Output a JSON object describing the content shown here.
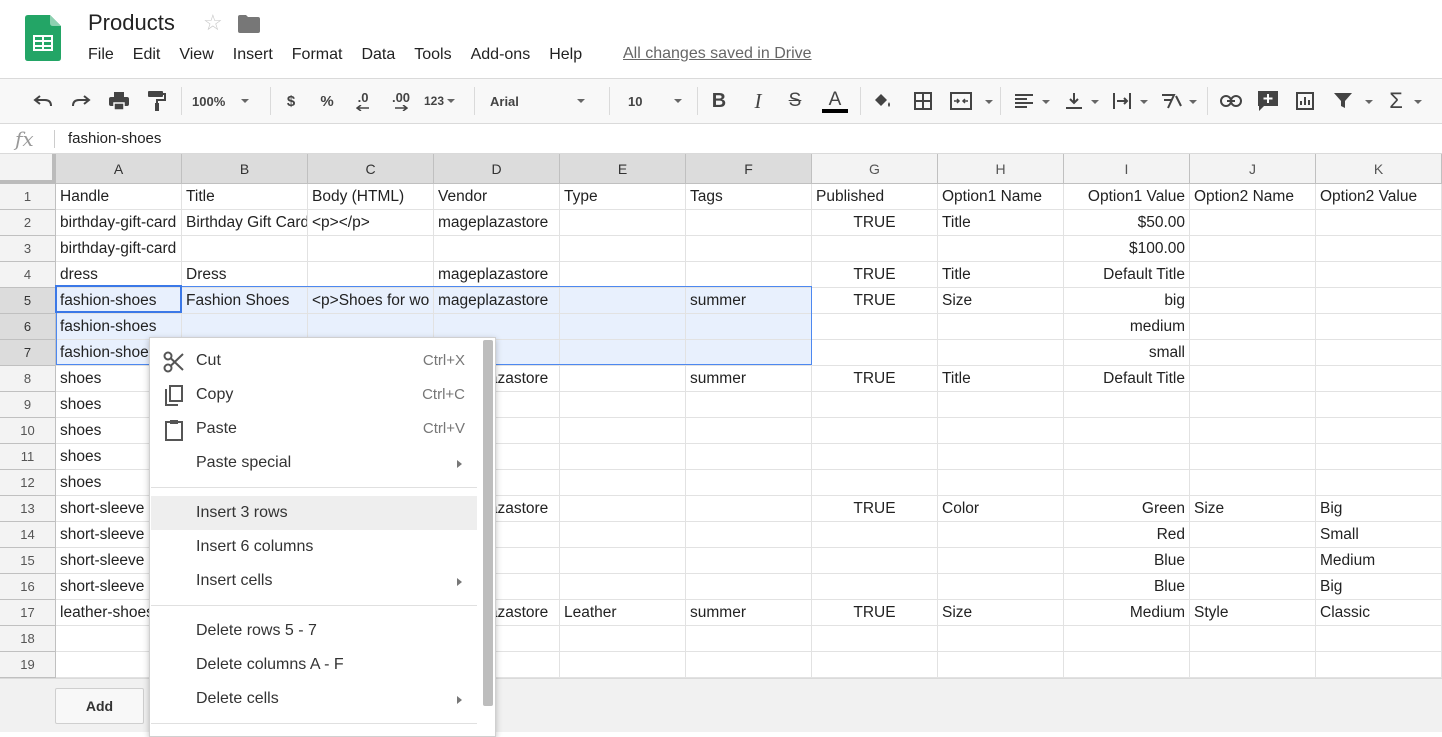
{
  "app": {
    "doc_title": "Products",
    "save_status": "All changes saved in Drive",
    "colors": {
      "sheets_green": "#23a566",
      "selection_blue": "#4d88f0",
      "selection_fill": "#e8f0fd"
    }
  },
  "menubar": [
    "File",
    "Edit",
    "View",
    "Insert",
    "Format",
    "Data",
    "Tools",
    "Add-ons",
    "Help"
  ],
  "toolbar": {
    "zoom": "100%",
    "currency": "$",
    "percent": "%",
    "decrease_decimal": ".0",
    "increase_decimal": ".00",
    "more_formats": "123",
    "font": "Arial",
    "font_size": "10",
    "bold": "B",
    "italic": "I",
    "strikethrough": "S",
    "text_color": "A"
  },
  "formula_bar": {
    "fx": "fx",
    "value": "fashion-shoes"
  },
  "grid": {
    "columns": [
      "A",
      "B",
      "C",
      "D",
      "E",
      "F",
      "G",
      "H",
      "I",
      "J",
      "K"
    ],
    "selected_columns": [
      0,
      1,
      2,
      3,
      4,
      5
    ],
    "rows": [
      {
        "num": "1",
        "cells": [
          "Handle",
          "Title",
          "Body (HTML)",
          "Vendor",
          "Type",
          "Tags",
          "Published",
          "Option1 Name",
          "Option1 Value",
          "Option2 Name",
          "Option2 Value"
        ]
      },
      {
        "num": "2",
        "cells": [
          "birthday-gift-card",
          "Birthday Gift Card",
          "<p></p>",
          "mageplazastore",
          "",
          "",
          "TRUE",
          "Title",
          "$50.00",
          "",
          ""
        ]
      },
      {
        "num": "3",
        "cells": [
          "birthday-gift-card",
          "",
          "",
          "",
          "",
          "",
          "",
          "",
          "$100.00",
          "",
          ""
        ]
      },
      {
        "num": "4",
        "cells": [
          "dress",
          "Dress",
          "",
          "mageplazastore",
          "",
          "",
          "TRUE",
          "Title",
          "Default Title",
          "",
          ""
        ]
      },
      {
        "num": "5",
        "cells": [
          "fashion-shoes",
          "Fashion Shoes",
          "<p>Shoes for wo",
          "mageplazastore",
          "",
          "summer",
          "TRUE",
          "Size",
          "big",
          "",
          ""
        ]
      },
      {
        "num": "6",
        "cells": [
          "fashion-shoes",
          "",
          "",
          "",
          "",
          "",
          "",
          "",
          "medium",
          "",
          ""
        ]
      },
      {
        "num": "7",
        "cells": [
          "fashion-shoes",
          "",
          "",
          "",
          "",
          "",
          "",
          "",
          "small",
          "",
          ""
        ]
      },
      {
        "num": "8",
        "cells": [
          "shoes",
          "",
          "",
          "mageplazastore",
          "",
          "summer",
          "TRUE",
          "Title",
          "Default Title",
          "",
          ""
        ]
      },
      {
        "num": "9",
        "cells": [
          "shoes",
          "",
          "",
          "",
          "",
          "",
          "",
          "",
          "",
          "",
          ""
        ]
      },
      {
        "num": "10",
        "cells": [
          "shoes",
          "",
          "",
          "",
          "",
          "",
          "",
          "",
          "",
          "",
          ""
        ]
      },
      {
        "num": "11",
        "cells": [
          "shoes",
          "",
          "",
          "",
          "",
          "",
          "",
          "",
          "",
          "",
          ""
        ]
      },
      {
        "num": "12",
        "cells": [
          "shoes",
          "",
          "",
          "",
          "",
          "",
          "",
          "",
          "",
          "",
          ""
        ]
      },
      {
        "num": "13",
        "cells": [
          "short-sleeve",
          "",
          "",
          "mageplazastore",
          "",
          "",
          "TRUE",
          "Color",
          "Green",
          "Size",
          "Big"
        ]
      },
      {
        "num": "14",
        "cells": [
          "short-sleeve",
          "",
          "",
          "",
          "",
          "",
          "",
          "",
          "Red",
          "",
          "Small"
        ]
      },
      {
        "num": "15",
        "cells": [
          "short-sleeve",
          "",
          "",
          "",
          "",
          "",
          "",
          "",
          "Blue",
          "",
          "Medium"
        ]
      },
      {
        "num": "16",
        "cells": [
          "short-sleeve",
          "",
          "",
          "",
          "",
          "",
          "",
          "",
          "Blue",
          "",
          "Big"
        ]
      },
      {
        "num": "17",
        "cells": [
          "leather-shoes",
          "",
          "",
          "mageplazastore",
          "Leather",
          "summer",
          "TRUE",
          "Size",
          "Medium",
          "Style",
          "Classic"
        ]
      },
      {
        "num": "18",
        "cells": [
          "",
          "",
          "",
          "",
          "",
          "",
          "",
          "",
          "",
          "",
          ""
        ]
      },
      {
        "num": "19",
        "cells": [
          "",
          "",
          "",
          "",
          "",
          "",
          "",
          "",
          "",
          "",
          ""
        ]
      }
    ]
  },
  "footer": {
    "add_label": "Add"
  },
  "context_menu": {
    "items": [
      {
        "label": "Cut",
        "shortcut": "Ctrl+X",
        "icon": "scissors-icon"
      },
      {
        "label": "Copy",
        "shortcut": "Ctrl+C",
        "icon": "copy-icon"
      },
      {
        "label": "Paste",
        "shortcut": "Ctrl+V",
        "icon": "clipboard-icon"
      },
      {
        "label": "Paste special",
        "submenu": true
      },
      {
        "label": "Insert 3 rows",
        "hovered": true
      },
      {
        "label": "Insert 6 columns"
      },
      {
        "label": "Insert cells",
        "submenu": true
      },
      {
        "label": "Delete rows 5 - 7"
      },
      {
        "label": "Delete columns A - F"
      },
      {
        "label": "Delete cells",
        "submenu": true
      }
    ]
  }
}
